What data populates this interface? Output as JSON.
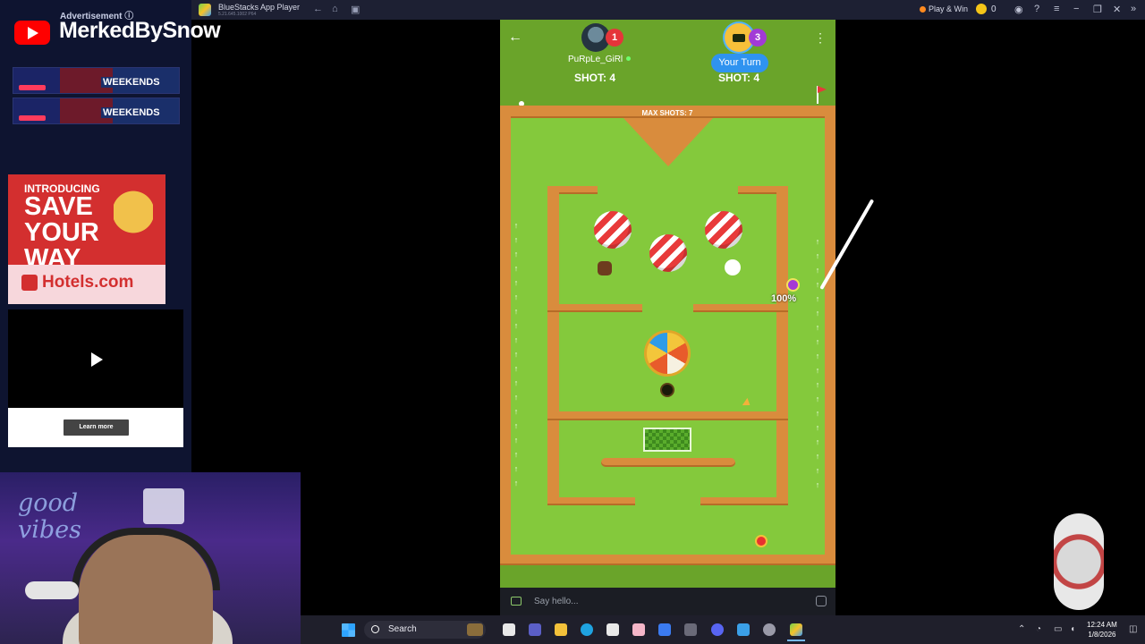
{
  "titlebar": {
    "app_name": "BlueStacks App Player",
    "app_sub": "5.21.645.1002 P64",
    "play_win": "Play & Win",
    "coin_count": "0"
  },
  "ads": {
    "label": "Advertisement ⓘ",
    "channel_name": "MerkedBySnow",
    "banner_text": "WEEKENDS",
    "hotels_intro": "INTRODUCING",
    "hotels_headline": "SAVE YOUR WAY",
    "hotels_brand": "Hotels.com",
    "learn_more": "Learn more"
  },
  "webcam": {
    "neon": "good vibes"
  },
  "game": {
    "player1": {
      "name": "PuRpLe_GiRl",
      "badge": "1",
      "shot": "SHOT: 4"
    },
    "player2": {
      "turn_label": "Your Turn",
      "badge": "3",
      "shot": "SHOT: 4"
    },
    "max_shots": "MAX SHOTS: 7",
    "power": "100%",
    "chat_placeholder": "Say hello..."
  },
  "taskbar": {
    "search": "Search",
    "time": "12:24 AM",
    "date": "1/8/2026"
  },
  "colors": {
    "grass": "#84c93c",
    "wall": "#d98c3d",
    "turn_pill": "#2f93f0",
    "bluestacks_bar": "#1d2033"
  }
}
